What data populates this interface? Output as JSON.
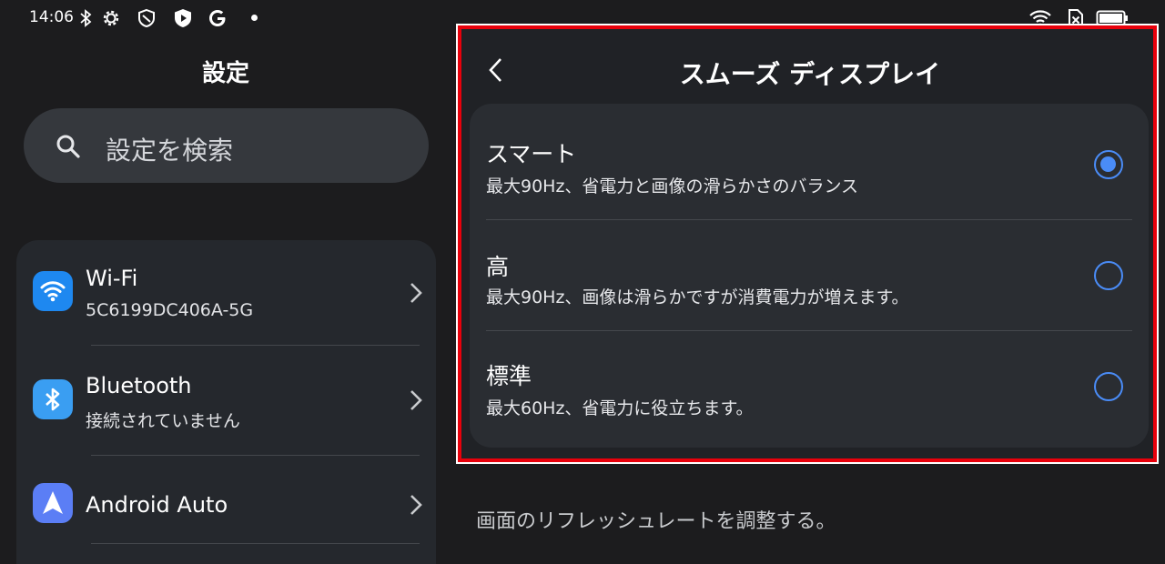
{
  "status_bar": {
    "time": "14:06",
    "left_icons": [
      "bluetooth-icon",
      "gear-icon",
      "shield-icon",
      "play-shield-icon",
      "google-icon",
      "dot-icon"
    ],
    "right_icons": [
      "wifi-icon",
      "no-sim-icon",
      "battery-icon"
    ]
  },
  "left": {
    "title": "設定",
    "search": {
      "placeholder": "設定を検索",
      "icon": "search-icon"
    },
    "items": [
      {
        "title": "Wi-Fi",
        "subtitle": "5C6199DC406A-5G",
        "icon": "wifi-icon",
        "icon_color": "#1e88f0"
      },
      {
        "title": "Bluetooth",
        "subtitle": "接続されていません",
        "icon": "bluetooth-icon",
        "icon_color": "#3a9ef2"
      },
      {
        "title": "Android Auto",
        "subtitle": "",
        "icon": "android-auto-icon",
        "icon_color": "#5b7ef5"
      }
    ]
  },
  "right": {
    "title": "スムーズ ディスプレイ",
    "options": [
      {
        "title": "スマート",
        "desc": "最大90Hz、省電力と画像の滑らかさのバランス",
        "selected": true
      },
      {
        "title": "高",
        "desc": "最大90Hz、画像は滑らかですが消費電力が増えます。",
        "selected": false
      },
      {
        "title": "標準",
        "desc": "最大60Hz、省電力に役立ちます。",
        "selected": false
      }
    ],
    "footer": "画面のリフレッシュレートを調整する。"
  },
  "colors": {
    "background": "#1c1c1e",
    "accent": "#4a8cf7",
    "highlight_border": "#e8000b"
  }
}
